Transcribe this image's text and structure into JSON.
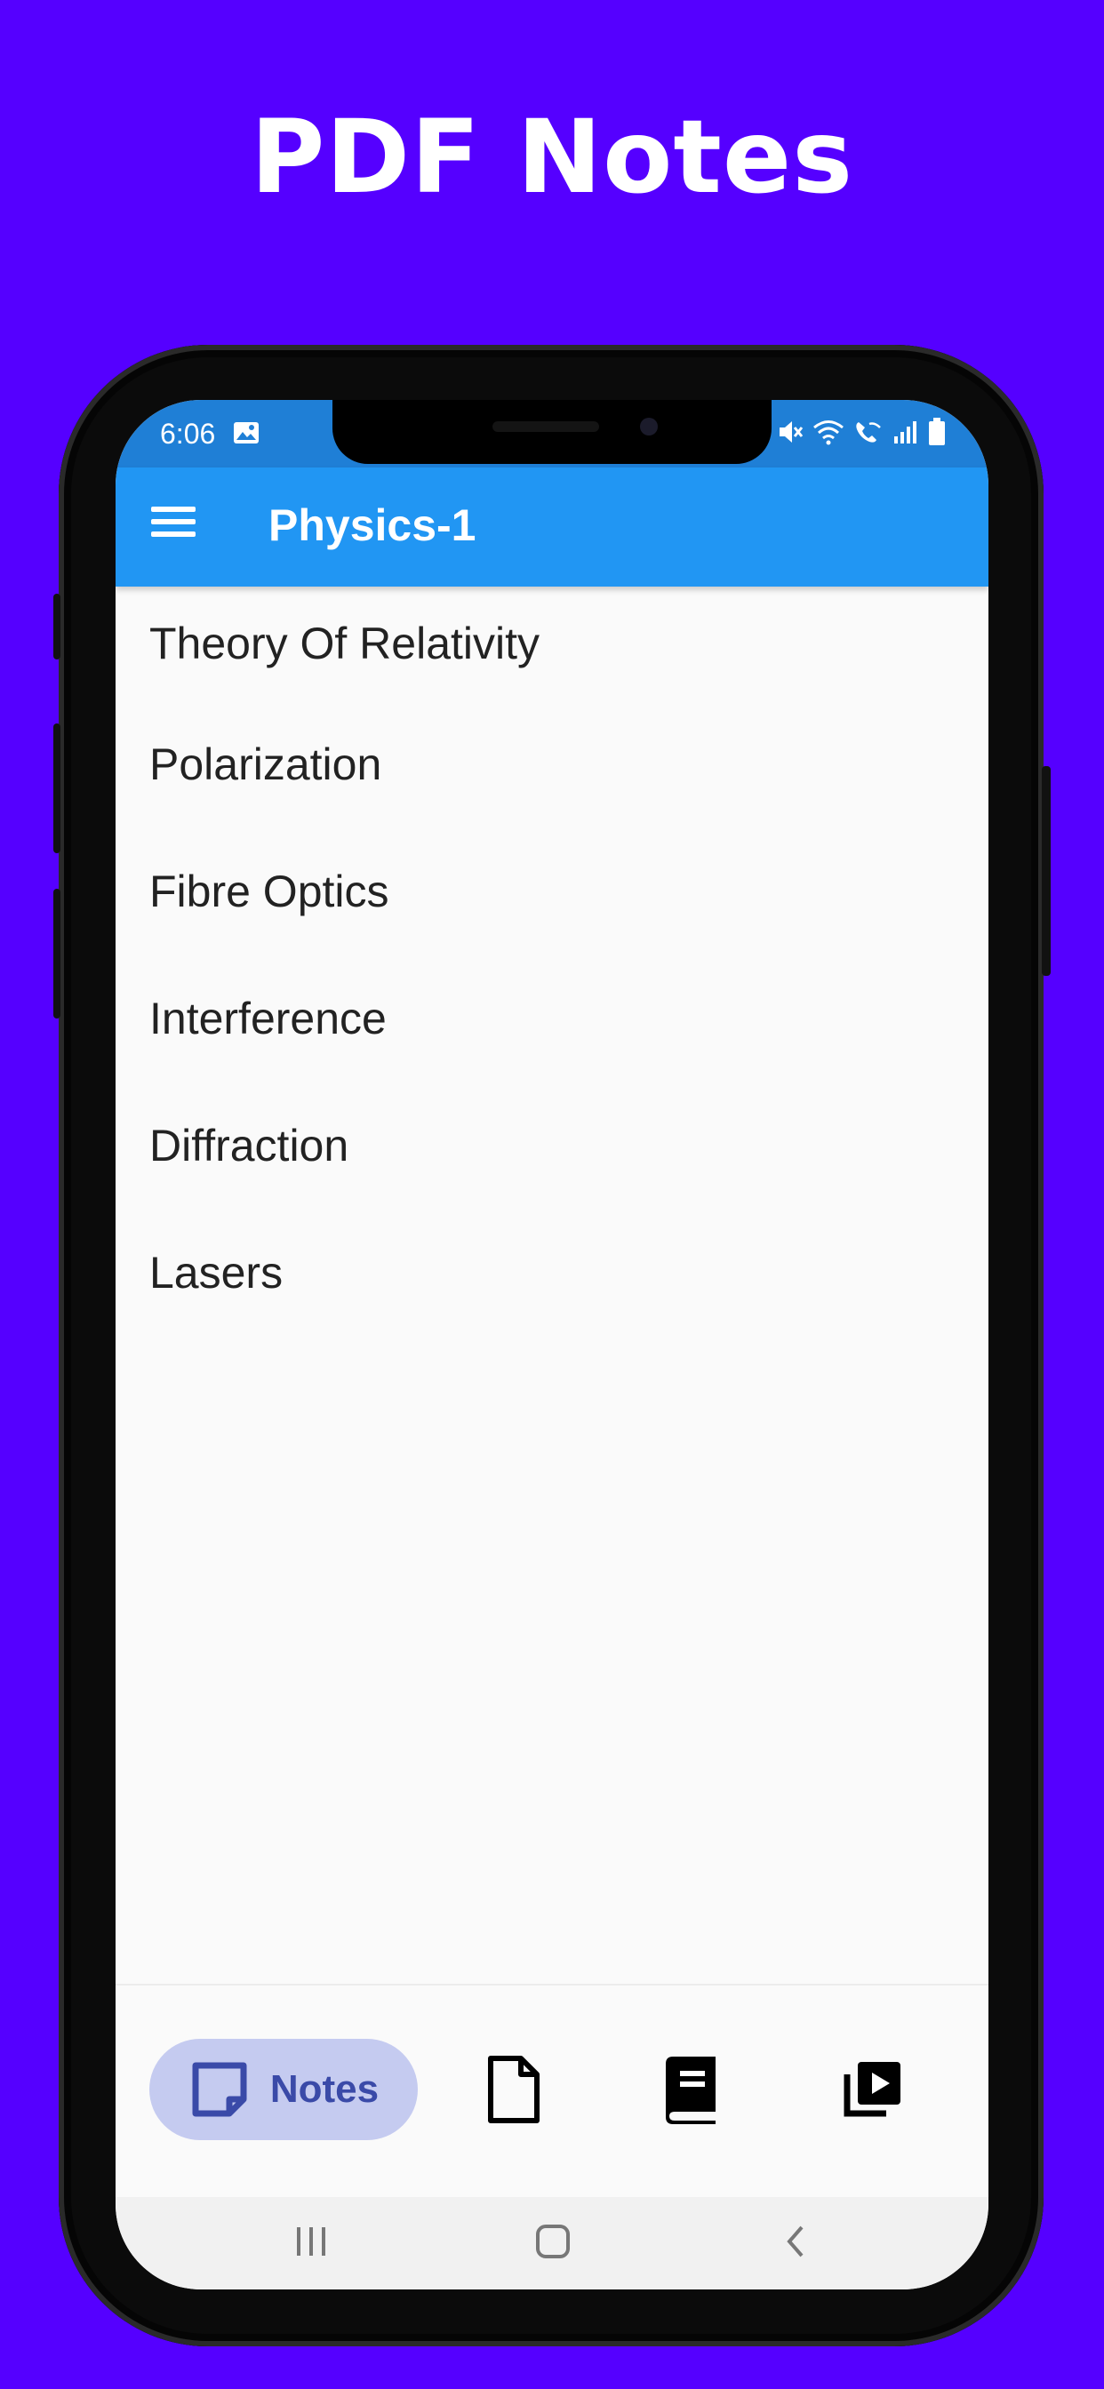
{
  "headline": "PDF Notes",
  "status_bar": {
    "time": "6:06"
  },
  "app_bar": {
    "title": "Physics-1"
  },
  "list": {
    "items": [
      "Theory Of Relativity",
      "Polarization",
      "Fibre Optics",
      "Interference",
      "Diffraction",
      "Lasers"
    ]
  },
  "bottom_nav": {
    "items": [
      {
        "label": "Notes",
        "icon": "sticky-note-icon",
        "selected": true
      },
      {
        "label": "",
        "icon": "document-icon",
        "selected": false
      },
      {
        "label": "",
        "icon": "book-icon",
        "selected": false
      },
      {
        "label": "",
        "icon": "video-library-icon",
        "selected": false
      }
    ]
  },
  "colors": {
    "background": "#5500ff",
    "app_bar": "#2196f3",
    "status_bar": "#1f7fd6",
    "nav_selected_pill": "#c5cbf0",
    "nav_selected_text": "#3a4aa8"
  }
}
